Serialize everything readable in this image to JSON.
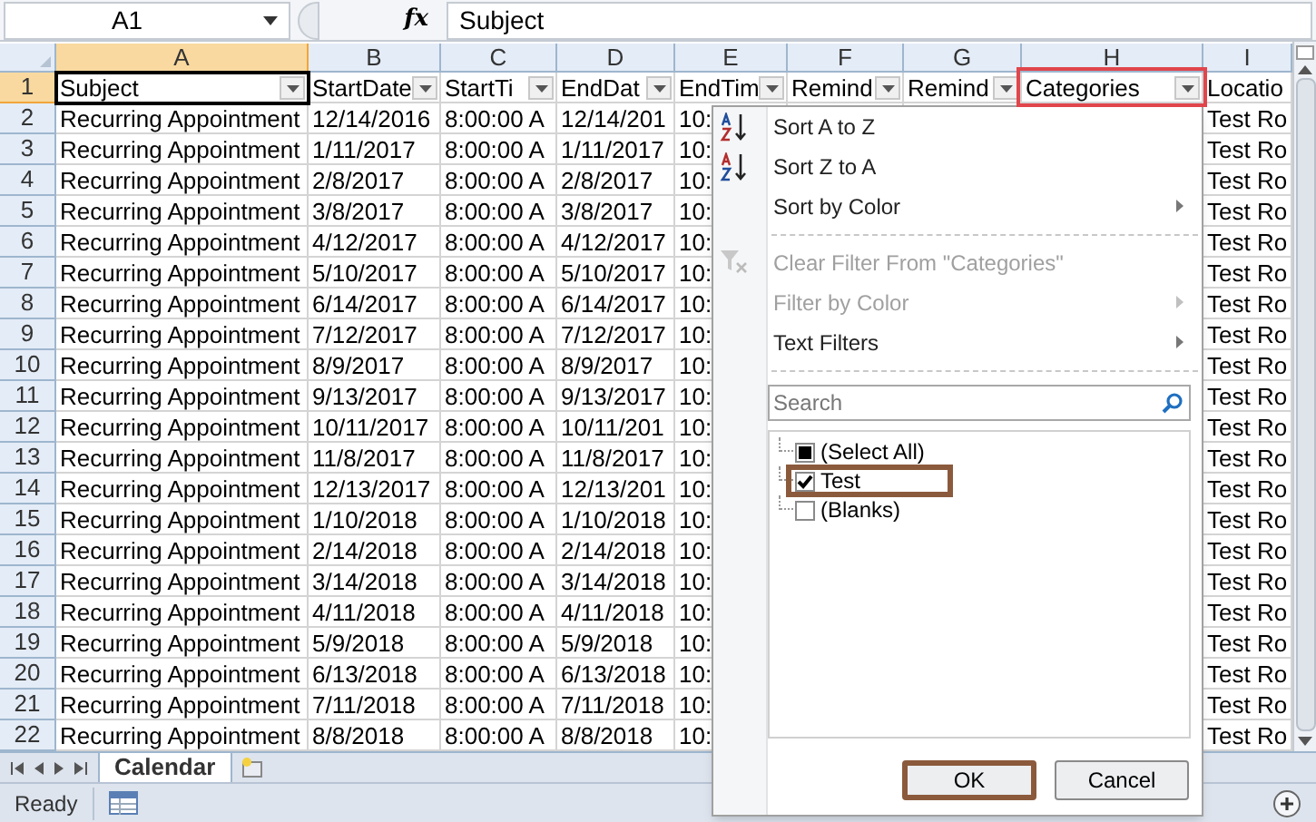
{
  "name_box": "A1",
  "formula_label": "fx",
  "formula": "Subject",
  "columns": [
    {
      "label": "A",
      "selected": true
    },
    {
      "label": "B",
      "selected": false
    },
    {
      "label": "C",
      "selected": false
    },
    {
      "label": "D",
      "selected": false
    },
    {
      "label": "E",
      "selected": false
    },
    {
      "label": "F",
      "selected": false
    },
    {
      "label": "G",
      "selected": false
    },
    {
      "label": "H",
      "selected": false
    },
    {
      "label": "I",
      "selected": false
    }
  ],
  "header_row": {
    "number": "1",
    "cells": [
      {
        "text": "Subject",
        "highlighted": false
      },
      {
        "text": "StartDate",
        "highlighted": false
      },
      {
        "text": "StartTi",
        "highlighted": false
      },
      {
        "text": "EndDat",
        "highlighted": false
      },
      {
        "text": "EndTim",
        "highlighted": false
      },
      {
        "text": "Remind",
        "highlighted": false
      },
      {
        "text": "Remind",
        "highlighted": false
      },
      {
        "text": "Categories",
        "highlighted": true
      },
      {
        "text": "Locatio",
        "highlighted": false,
        "filter_button": false
      }
    ]
  },
  "rows": [
    {
      "number": "2",
      "cells": [
        "Recurring Appointment",
        "12/14/2016",
        "8:00:00 A",
        "12/14/201",
        "10:",
        "Test Ro"
      ]
    },
    {
      "number": "3",
      "cells": [
        "Recurring Appointment",
        "1/11/2017",
        "8:00:00 A",
        "1/11/2017",
        "10:",
        "Test Ro"
      ]
    },
    {
      "number": "4",
      "cells": [
        "Recurring Appointment",
        "2/8/2017",
        "8:00:00 A",
        "2/8/2017",
        "10:",
        "Test Ro"
      ]
    },
    {
      "number": "5",
      "cells": [
        "Recurring Appointment",
        "3/8/2017",
        "8:00:00 A",
        "3/8/2017",
        "10:",
        "Test Ro"
      ]
    },
    {
      "number": "6",
      "cells": [
        "Recurring Appointment",
        "4/12/2017",
        "8:00:00 A",
        "4/12/2017",
        "10:",
        "Test Ro"
      ]
    },
    {
      "number": "7",
      "cells": [
        "Recurring Appointment",
        "5/10/2017",
        "8:00:00 A",
        "5/10/2017",
        "10:",
        "Test Ro"
      ]
    },
    {
      "number": "8",
      "cells": [
        "Recurring Appointment",
        "6/14/2017",
        "8:00:00 A",
        "6/14/2017",
        "10:",
        "Test Ro"
      ]
    },
    {
      "number": "9",
      "cells": [
        "Recurring Appointment",
        "7/12/2017",
        "8:00:00 A",
        "7/12/2017",
        "10:",
        "Test Ro"
      ]
    },
    {
      "number": "10",
      "cells": [
        "Recurring Appointment",
        "8/9/2017",
        "8:00:00 A",
        "8/9/2017",
        "10:",
        "Test Ro"
      ]
    },
    {
      "number": "11",
      "cells": [
        "Recurring Appointment",
        "9/13/2017",
        "8:00:00 A",
        "9/13/2017",
        "10:",
        "Test Ro"
      ]
    },
    {
      "number": "12",
      "cells": [
        "Recurring Appointment",
        "10/11/2017",
        "8:00:00 A",
        "10/11/201",
        "10:",
        "Test Ro"
      ]
    },
    {
      "number": "13",
      "cells": [
        "Recurring Appointment",
        "11/8/2017",
        "8:00:00 A",
        "11/8/2017",
        "10:",
        "Test Ro"
      ]
    },
    {
      "number": "14",
      "cells": [
        "Recurring Appointment",
        "12/13/2017",
        "8:00:00 A",
        "12/13/201",
        "10:",
        "Test Ro"
      ]
    },
    {
      "number": "15",
      "cells": [
        "Recurring Appointment",
        "1/10/2018",
        "8:00:00 A",
        "1/10/2018",
        "10:",
        "Test Ro"
      ]
    },
    {
      "number": "16",
      "cells": [
        "Recurring Appointment",
        "2/14/2018",
        "8:00:00 A",
        "2/14/2018",
        "10:",
        "Test Ro"
      ]
    },
    {
      "number": "17",
      "cells": [
        "Recurring Appointment",
        "3/14/2018",
        "8:00:00 A",
        "3/14/2018",
        "10:",
        "Test Ro"
      ]
    },
    {
      "number": "18",
      "cells": [
        "Recurring Appointment",
        "4/11/2018",
        "8:00:00 A",
        "4/11/2018",
        "10:",
        "Test Ro"
      ]
    },
    {
      "number": "19",
      "cells": [
        "Recurring Appointment",
        "5/9/2018",
        "8:00:00 A",
        "5/9/2018",
        "10:",
        "Test Ro"
      ]
    },
    {
      "number": "20",
      "cells": [
        "Recurring Appointment",
        "6/13/2018",
        "8:00:00 A",
        "6/13/2018",
        "10:",
        "Test Ro"
      ]
    },
    {
      "number": "21",
      "cells": [
        "Recurring Appointment",
        "7/11/2018",
        "8:00:00 A",
        "7/11/2018",
        "10:",
        "Test Ro"
      ]
    },
    {
      "number": "22",
      "cells": [
        "Recurring Appointment",
        "8/8/2018",
        "8:00:00 A",
        "8/8/2018",
        "10:",
        "Test Ro"
      ]
    }
  ],
  "filter_menu": {
    "items": [
      {
        "kind": "sort_ascending",
        "label": "Sort A to Z",
        "disabled": false,
        "submenu": false
      },
      {
        "kind": "sort_descending",
        "label": "Sort Z to A",
        "disabled": false,
        "submenu": false
      },
      {
        "kind": "plain",
        "label": "Sort by Color",
        "disabled": false,
        "submenu": true
      },
      {
        "kind": "separator"
      },
      {
        "kind": "clear_filter",
        "label": "Clear Filter From \"Categories\"",
        "disabled": true,
        "submenu": false
      },
      {
        "kind": "plain",
        "label": "Filter by Color",
        "disabled": true,
        "submenu": true
      },
      {
        "kind": "plain",
        "label": "Text Filters",
        "disabled": false,
        "submenu": true
      },
      {
        "kind": "separator"
      }
    ],
    "search": {
      "placeholder": "Search"
    },
    "values": [
      {
        "label": "(Select All)",
        "checked": false,
        "partial": true,
        "highlighted": false
      },
      {
        "label": "Test",
        "checked": true,
        "partial": false,
        "highlighted": true
      },
      {
        "label": "(Blanks)",
        "checked": false,
        "partial": false,
        "highlighted": false
      }
    ],
    "buttons": [
      {
        "label": "OK",
        "highlighted": true
      },
      {
        "label": "Cancel",
        "highlighted": false
      }
    ]
  },
  "sheet_tabs": [
    {
      "label": "Calendar",
      "selected": true
    }
  ],
  "status": "Ready"
}
